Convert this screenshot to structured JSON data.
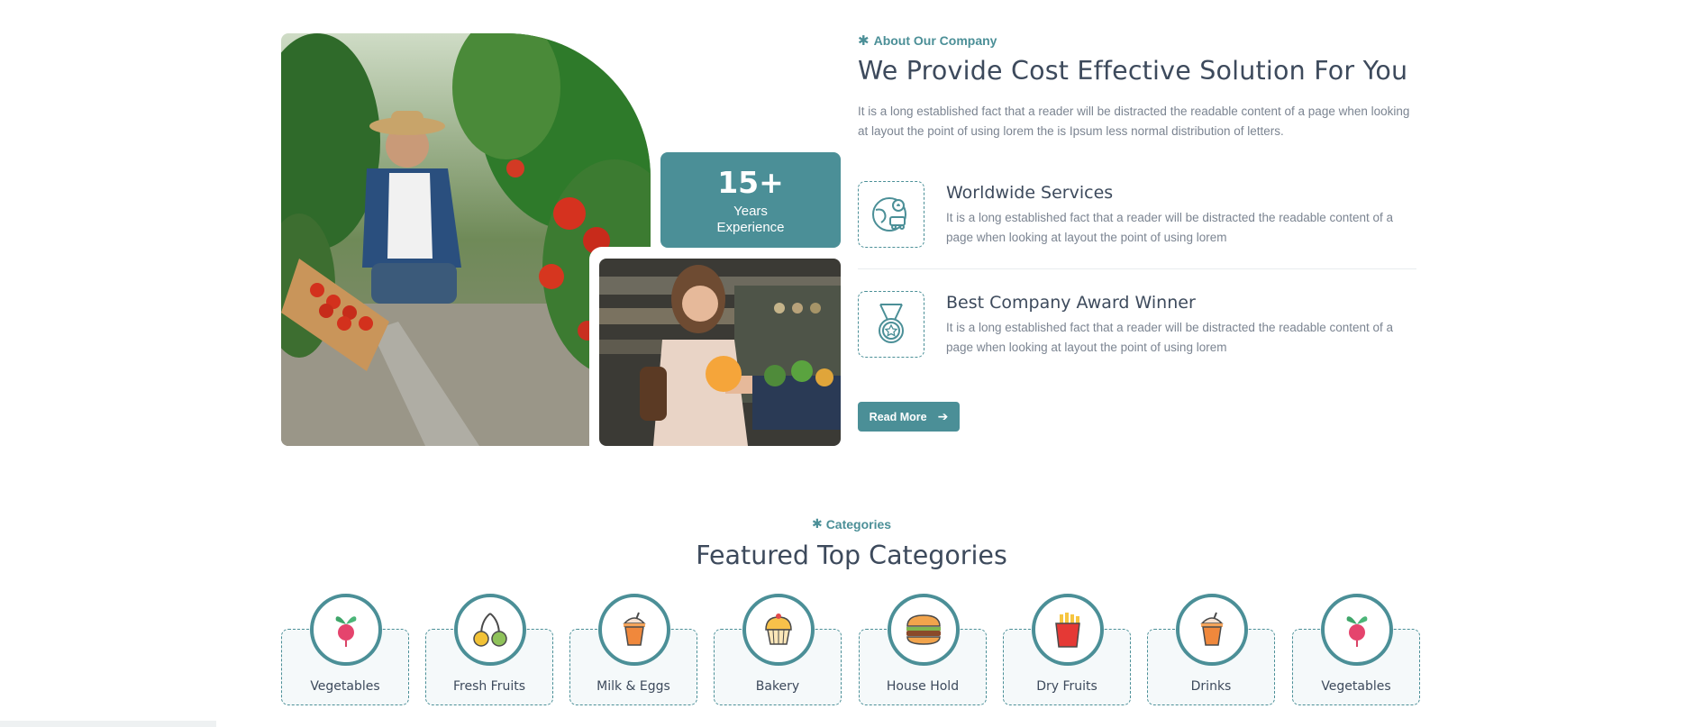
{
  "colors": {
    "accent": "#4b8f97",
    "heading": "#3d4a5c",
    "body": "#7b8491"
  },
  "about": {
    "eyebrow": "About Our Company",
    "title": "We Provide Cost Effective Solution For You",
    "description": "It is a long established fact that a reader will be distracted the readable content of a page when looking at layout the point of using lorem the is Ipsum less normal distribution of letters.",
    "experience_number": "15+",
    "experience_label_1": "Years",
    "experience_label_2": "Experience",
    "features": [
      {
        "title": "Worldwide Services",
        "description": "It is a long established fact that a reader will be distracted the readable content of a page when looking at layout the point of using lorem",
        "icon": "globe-delivery-icon"
      },
      {
        "title": "Best Company Award Winner",
        "description": "It is a long established fact that a reader will be distracted the readable content of a page when looking at layout the point of using lorem",
        "icon": "award-medal-icon"
      }
    ],
    "read_more_label": "Read More",
    "read_more_icon": "arrow-right-icon"
  },
  "categories": {
    "eyebrow": "Categories",
    "title": "Featured Top Categories",
    "items": [
      {
        "label": "Vegetables",
        "icon": "radish-icon"
      },
      {
        "label": "Fresh Fruits",
        "icon": "cherries-icon"
      },
      {
        "label": "Milk & Eggs",
        "icon": "milkshake-icon"
      },
      {
        "label": "Bakery",
        "icon": "cupcake-icon"
      },
      {
        "label": "House Hold",
        "icon": "burger-icon"
      },
      {
        "label": "Dry Fruits",
        "icon": "fries-icon"
      },
      {
        "label": "Drinks",
        "icon": "milkshake-icon"
      },
      {
        "label": "Vegetables",
        "icon": "radish-icon"
      }
    ]
  }
}
